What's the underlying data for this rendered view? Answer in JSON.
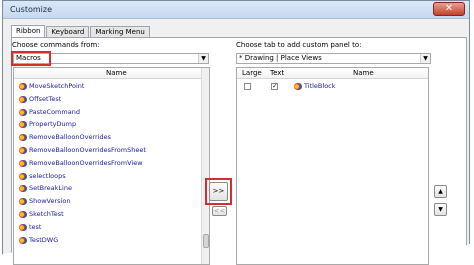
{
  "window": {
    "title": "Customize",
    "close_glyph": "✕"
  },
  "tabs": [
    {
      "label": "Ribbon",
      "active": true
    },
    {
      "label": "Keyboard",
      "active": false
    },
    {
      "label": "Marking Menu",
      "active": false
    }
  ],
  "left": {
    "label": "Choose commands from:",
    "combo_value": "Macros",
    "list_header": "Name",
    "items": [
      "MoveSketchPoint",
      "OffsetTest",
      "PasteCommand",
      "PropertyDump",
      "RemoveBalloonOverrides",
      "RemoveBalloonOverridesFromSheet",
      "RemoveBalloonOverridesFromView",
      "selectloops",
      "SetBreakLine",
      "ShowVersion",
      "SketchTest",
      "test",
      "TestDWG"
    ]
  },
  "middle": {
    "add_label": ">>",
    "remove_label": "<<"
  },
  "right": {
    "label": "Choose tab to add custom panel to:",
    "combo_value": "* Drawing | Place Views",
    "headers": {
      "large": "Large",
      "text": "Text",
      "name": "Name"
    },
    "rows": [
      {
        "large": false,
        "text": true,
        "name": "TitleBlock"
      }
    ],
    "check_glyph": "✓",
    "up_glyph": "▲",
    "down_glyph": "▼"
  },
  "icons": {
    "combo_arrow": "▼"
  }
}
